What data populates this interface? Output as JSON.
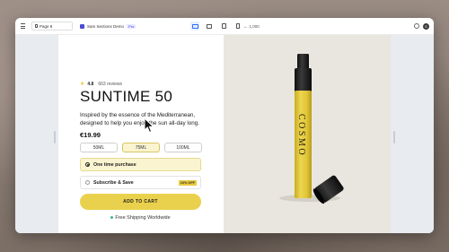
{
  "toolbar": {
    "page_label": "Page 8",
    "site_name": "Sam Sections Demo",
    "site_badge": "Pro",
    "viewport_width": "1,000"
  },
  "product": {
    "rating": "4.8",
    "reviews": "663 reviews",
    "title": "SUNTIME 50",
    "description": "Inspired by the essence of the Mediterranean, designed to help you enjoy the sun all-day long.",
    "price": "€19.99",
    "sizes": [
      "50ML",
      "75ML",
      "100ML"
    ],
    "selected_size": "75ML",
    "options": {
      "one_time": "One time purchase",
      "subscribe": "Subscribe & Save",
      "discount": "10% OFF"
    },
    "cart_label": "ADD TO CART",
    "shipping": "Free Shipping Worldwide",
    "brand_on_bottle": "COSMO"
  },
  "colors": {
    "accent_yellow": "#e9d14d",
    "bottle_yellow": "#e6cc3f",
    "image_background": "#e9e6df"
  }
}
